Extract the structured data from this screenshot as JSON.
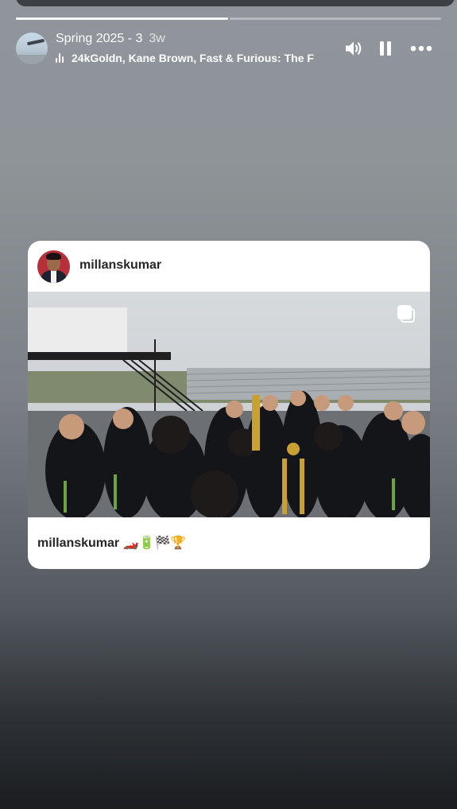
{
  "story": {
    "title": "Spring 2025 - 3",
    "time": "3w",
    "music": "24kGoldn, Kane Brown, Fast & Furious: The F",
    "progress_segments_total": 2,
    "progress_segments_done": 1
  },
  "icons": {
    "volume": "speaker-icon",
    "pause": "pause-icon",
    "more": "more-icon",
    "music": "music-bars-icon",
    "carousel": "carousel-icon"
  },
  "post": {
    "username": "millanskumar",
    "caption_user": "millanskumar",
    "caption_text": "🏎️🔋🏁🏆"
  },
  "colors": {
    "card_bg": "#ffffff",
    "text_dark": "#262626"
  }
}
